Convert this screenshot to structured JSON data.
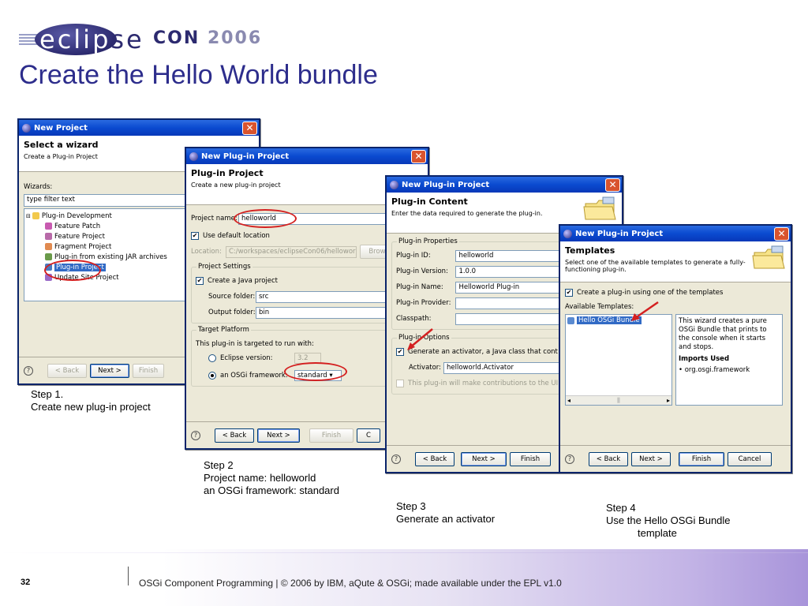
{
  "logo": {
    "part1": "eclip",
    "part2": "se",
    "con": "CON",
    "year": "2006"
  },
  "title": "Create the Hello World bundle",
  "w1": {
    "titlebar": "New Project",
    "heading": "Select a wizard",
    "subheading": "Create a Plug-in Project",
    "wizards_label": "Wizards:",
    "filter_value": "type filter text",
    "tree": [
      "Plug-in Development",
      "Feature Patch",
      "Feature Project",
      "Fragment Project",
      "Plug-in from existing JAR archives",
      "Plug-in Project",
      "Update Site Project"
    ],
    "back": "< Back",
    "next": "Next >",
    "finish": "Finish"
  },
  "w2": {
    "titlebar": "New Plug-in Project",
    "heading": "Plug-in Project",
    "subheading": "Create a new plug-in project",
    "project_name_label": "Project name:",
    "project_name_value": "helloworld",
    "use_default": "Use default location",
    "location_label": "Location:",
    "location_value": "C:/workspaces/eclipseCon06/hellowor",
    "browse": "Brow",
    "settings_group": "Project Settings",
    "create_java": "Create a Java project",
    "source_label": "Source folder:",
    "source_value": "src",
    "output_label": "Output folder:",
    "output_value": "bin",
    "platform_group": "Target Platform",
    "platform_desc": "This plug-in is targeted to run with:",
    "eclipse_version": "Eclipse version:",
    "eclipse_version_value": "3.2",
    "osgi_framework": "an OSGi framework:",
    "osgi_value": "standard",
    "back": "< Back",
    "next": "Next >",
    "finish": "Finish",
    "cancel": "C"
  },
  "w3": {
    "titlebar": "New Plug-in Project",
    "heading": "Plug-in Content",
    "subheading": "Enter the data required to generate the plug-in.",
    "props_group": "Plug-in Properties",
    "id_label": "Plug-in ID:",
    "id_value": "helloworld",
    "version_label": "Plug-in Version:",
    "version_value": "1.0.0",
    "name_label": "Plug-in Name:",
    "name_value": "Helloworld Plug-in",
    "provider_label": "Plug-in Provider:",
    "provider_value": "",
    "classpath_label": "Classpath:",
    "classpath_value": "",
    "options_group": "Plug-in Options",
    "generate": "Generate an activator, a Java class that cont",
    "activator_label": "Activator:",
    "activator_value": "helloworld.Activator",
    "ui_contrib": "This plug-in will make contributions to the UI",
    "back": "< Back",
    "next": "Next >",
    "finish": "Finish"
  },
  "w4": {
    "titlebar": "New Plug-in Project",
    "heading": "Templates",
    "subheading1": "Select one of the available templates to generate a fully-",
    "subheading2": "functioning plug-in.",
    "create_using": "Create a plug-in using one of the templates",
    "available": "Available Templates:",
    "template_item": "Hello OSGi Bundle",
    "desc": "This wizard creates a pure OSGi Bundle that prints to the console when it starts and stops.",
    "imports_used": "Imports Used",
    "import_item": "org.osgi.framework",
    "back": "< Back",
    "next": "Next >",
    "finish": "Finish",
    "cancel": "Cancel"
  },
  "captions": {
    "step1_a": "Step 1.",
    "step1_b": "Create new plug-in project",
    "step2_a": "Step 2",
    "step2_b": "Project name: helloworld",
    "step2_c": "an OSGi framework: standard",
    "step3_a": "Step 3",
    "step3_b": "Generate an activator",
    "step4_a": "Step 4",
    "step4_b": "Use the Hello OSGi Bundle",
    "step4_c": "template"
  },
  "footer": {
    "page": "32",
    "text": "OSGi Component Programming  | © 2006 by IBM, aQute & OSGi; made available under the EPL v1.0"
  }
}
